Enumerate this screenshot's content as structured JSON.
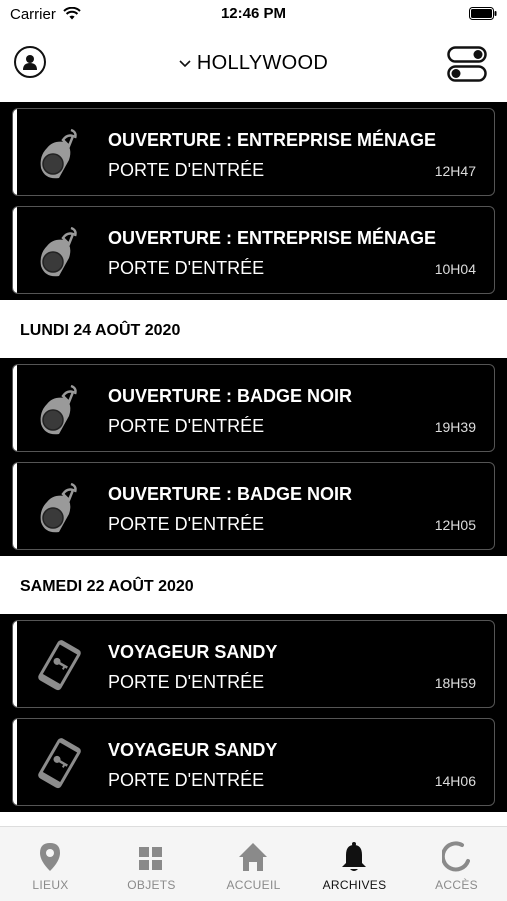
{
  "status_bar": {
    "carrier": "Carrier",
    "time": "12:46 PM"
  },
  "header": {
    "location": "HOLLYWOOD",
    "profile_icon": "user-circle-icon",
    "toggle_icon": "toggle-switches-icon"
  },
  "feed": [
    {
      "date": null,
      "events": [
        {
          "icon": "remote-fob-icon",
          "title": "OUVERTURE : ENTREPRISE MÉNAGE",
          "subtitle": "PORTE D'ENTRÉE",
          "time": "12H47"
        },
        {
          "icon": "remote-fob-icon",
          "title": "OUVERTURE : ENTREPRISE MÉNAGE",
          "subtitle": "PORTE D'ENTRÉE",
          "time": "10H04"
        }
      ]
    },
    {
      "date": "LUNDI 24 AOÛT 2020",
      "events": [
        {
          "icon": "remote-fob-icon",
          "title": "OUVERTURE : BADGE NOIR",
          "subtitle": "PORTE D'ENTRÉE",
          "time": "19H39"
        },
        {
          "icon": "remote-fob-icon",
          "title": "OUVERTURE : BADGE NOIR",
          "subtitle": "PORTE D'ENTRÉE",
          "time": "12H05"
        }
      ]
    },
    {
      "date": "SAMEDI 22 AOÛT 2020",
      "events": [
        {
          "icon": "phone-key-icon",
          "title": "VOYAGEUR SANDY",
          "subtitle": "PORTE D'ENTRÉE",
          "time": "18H59"
        },
        {
          "icon": "phone-key-icon",
          "title": "VOYAGEUR SANDY",
          "subtitle": "PORTE D'ENTRÉE",
          "time": "14H06"
        }
      ]
    }
  ],
  "tabs": [
    {
      "label": "LIEUX",
      "icon": "location-pin-icon",
      "active": false
    },
    {
      "label": "OBJETS",
      "icon": "grid-icon",
      "active": false
    },
    {
      "label": "ACCUEIL",
      "icon": "home-icon",
      "active": false
    },
    {
      "label": "ARCHIVES",
      "icon": "bell-icon",
      "active": true
    },
    {
      "label": "ACCÈS",
      "icon": "loading-arc-icon",
      "active": false
    }
  ],
  "colors": {
    "card_bg": "#000000",
    "accent_bar": "#ffffff",
    "tab_active": "#111111",
    "tab_inactive": "#8a8a8a"
  }
}
